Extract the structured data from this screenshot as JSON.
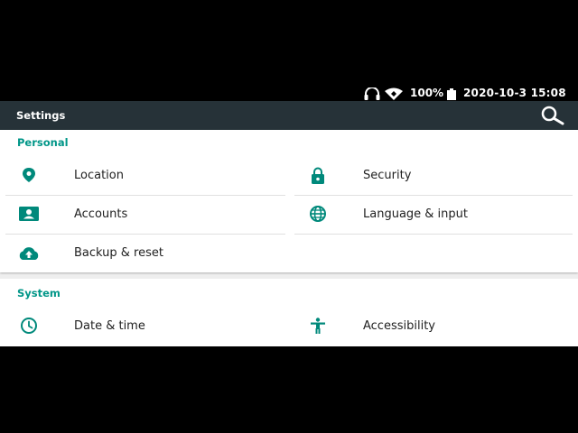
{
  "status_bar": {
    "battery": "100%",
    "datetime": "2020-10-3 15:08",
    "icons": [
      "headphones-icon",
      "wifi-icon",
      "battery-icon"
    ]
  },
  "toolbar": {
    "title": "Settings",
    "search_icon": "search-icon"
  },
  "sections": {
    "personal": {
      "header": "Personal",
      "items": [
        {
          "label": "Location",
          "icon": "location-pin-icon"
        },
        {
          "label": "Security",
          "icon": "lock-icon"
        },
        {
          "label": "Accounts",
          "icon": "account-card-icon"
        },
        {
          "label": "Language & input",
          "icon": "globe-icon"
        },
        {
          "label": "Backup & reset",
          "icon": "cloud-upload-icon"
        }
      ]
    },
    "system": {
      "header": "System",
      "items": [
        {
          "label": "Date & time",
          "icon": "clock-icon"
        },
        {
          "label": "Accessibility",
          "icon": "accessibility-icon"
        }
      ]
    }
  },
  "colors": {
    "toolbar_bg": "#263238",
    "accent": "#009688",
    "icon": "#00897b",
    "background": "#000000"
  }
}
